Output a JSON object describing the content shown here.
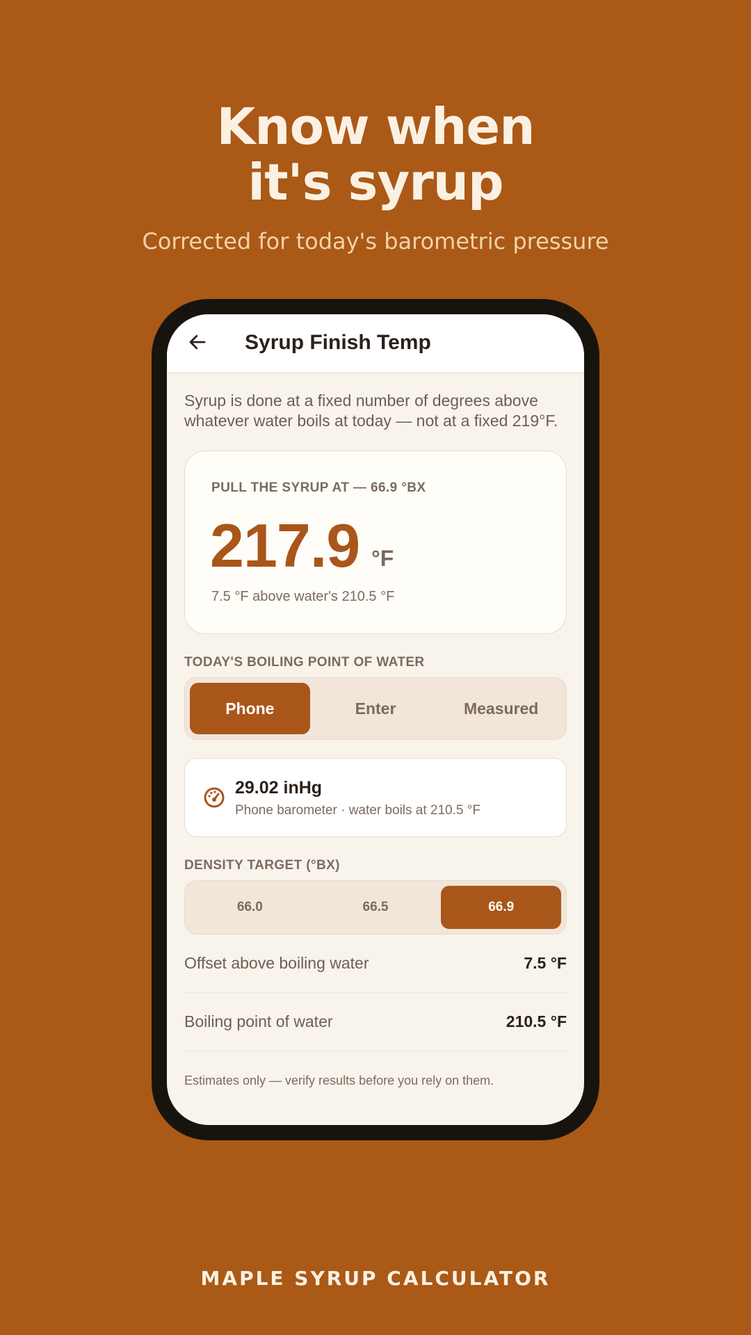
{
  "promo": {
    "headline_line1": "Know when",
    "headline_line2": "it's syrup",
    "subhead": "Corrected for today's barometric pressure",
    "brand": "MAPLE SYRUP CALCULATOR"
  },
  "colors": {
    "background": "#AA5917",
    "accent": "#A9561A",
    "screen": "#F8F4EC"
  },
  "appbar": {
    "back_icon": "arrow-left-icon",
    "title": "Syrup Finish Temp"
  },
  "intro": "Syrup is done at a fixed number of degrees above whatever water boils at today — not at a fixed 219°F.",
  "result": {
    "label": "PULL THE SYRUP AT — 66.9 °BX",
    "value": "217.9",
    "unit": "°F",
    "note": "7.5 °F above water's 210.5 °F"
  },
  "boiling_source": {
    "label": "TODAY'S BOILING POINT OF WATER",
    "options": [
      "Phone",
      "Enter",
      "Measured"
    ],
    "selected": "Phone"
  },
  "barometer": {
    "icon": "gauge-icon",
    "value": "29.02 inHg",
    "note": "Phone barometer · water boils at 210.5 °F"
  },
  "density": {
    "label": "DENSITY TARGET (°BX)",
    "options": [
      "66.0",
      "66.5",
      "66.9"
    ],
    "selected": "66.9"
  },
  "details": [
    {
      "label": "Offset above boiling water",
      "value": "7.5 °F"
    },
    {
      "label": "Boiling point of water",
      "value": "210.5 °F"
    }
  ],
  "footnote": "Estimates only — verify results before you rely on them."
}
